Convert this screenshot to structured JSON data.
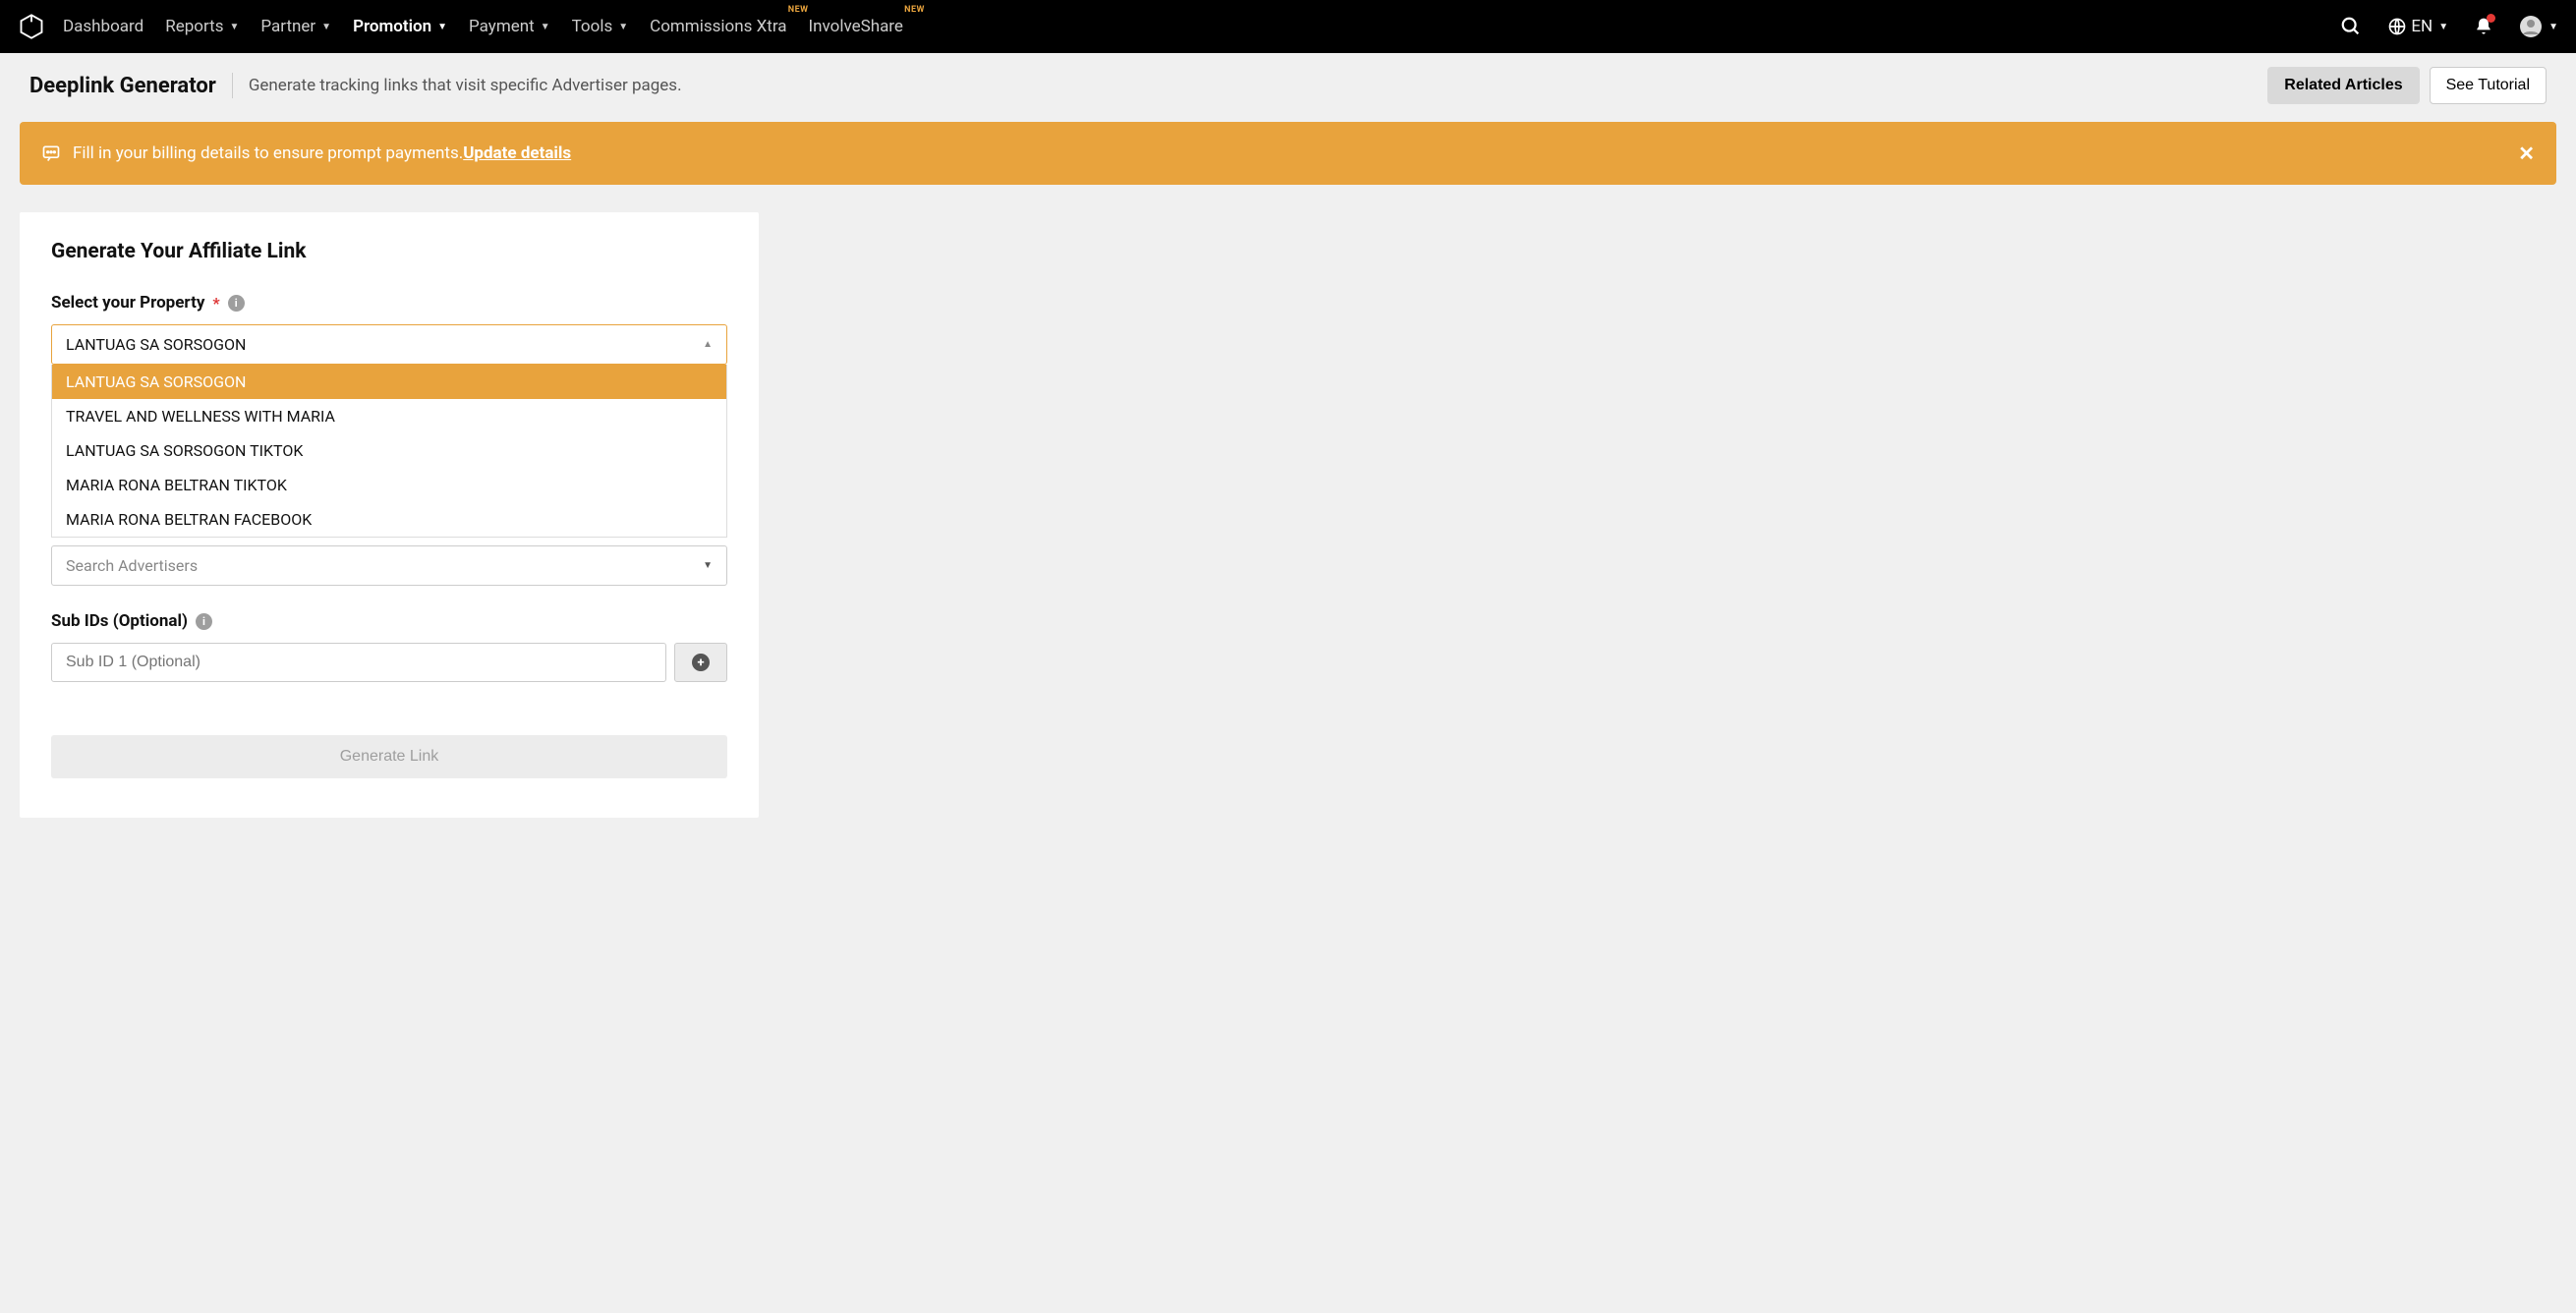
{
  "nav": {
    "items": [
      {
        "label": "Dashboard",
        "caret": false,
        "badge": null,
        "active": false
      },
      {
        "label": "Reports",
        "caret": true,
        "badge": null,
        "active": false
      },
      {
        "label": "Partner",
        "caret": true,
        "badge": null,
        "active": false
      },
      {
        "label": "Promotion",
        "caret": true,
        "badge": null,
        "active": true
      },
      {
        "label": "Payment",
        "caret": true,
        "badge": null,
        "active": false
      },
      {
        "label": "Tools",
        "caret": true,
        "badge": null,
        "active": false
      },
      {
        "label": "Commissions Xtra",
        "caret": false,
        "badge": "NEW",
        "active": false
      },
      {
        "label": "InvolveShare",
        "caret": false,
        "badge": "NEW",
        "active": false
      }
    ],
    "lang": "EN"
  },
  "page": {
    "title": "Deeplink Generator",
    "subtitle": "Generate tracking links that visit specific Advertiser pages.",
    "related_btn": "Related Articles",
    "tutorial_btn": "See Tutorial"
  },
  "banner": {
    "text": "Fill in your billing details to ensure prompt payments. ",
    "link": "Update details"
  },
  "card": {
    "heading": "Generate Your Affiliate Link",
    "property_label": "Select your Property",
    "property_selected": "LANTUAG SA SORSOGON",
    "property_options": [
      "LANTUAG SA SORSOGON",
      "TRAVEL AND WELLNESS WITH MARIA",
      "LANTUAG SA SORSOGON TIKTOK",
      "MARIA RONA BELTRAN TIKTOK",
      "MARIA RONA BELTRAN FACEBOOK"
    ],
    "advertiser_placeholder": "Search Advertisers",
    "subids_label": "Sub IDs (Optional)",
    "subid_placeholder": "Sub ID 1 (Optional)",
    "generate_label": "Generate Link"
  }
}
